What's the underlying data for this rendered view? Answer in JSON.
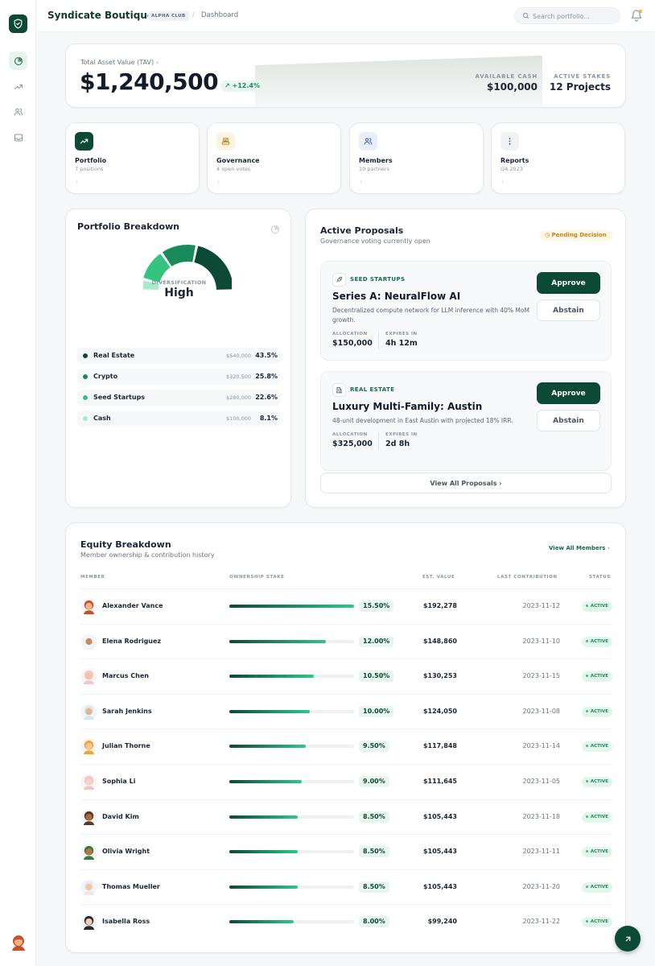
{
  "header": {
    "brand": "Syndicate Boutique",
    "badge": "ALPHA CLUB",
    "separator": "/",
    "breadcrumb": "Dashboard",
    "search_placeholder": "Search portfolio..."
  },
  "sidebar": {
    "items": [
      {
        "icon": "pie-chart-icon",
        "active": true
      },
      {
        "icon": "trending-up-icon",
        "active": false
      },
      {
        "icon": "users-icon",
        "active": false
      },
      {
        "icon": "inbox-icon",
        "active": false
      }
    ]
  },
  "tav": {
    "label": "Total Asset Value (TAV)",
    "value": "$1,240,500",
    "change": "+12.4%",
    "available_cash_label": "AVAILABLE CASH",
    "available_cash": "$100,000",
    "active_stakes_label": "ACTIVE STAKES",
    "active_stakes": "12 Projects"
  },
  "quick_links": [
    {
      "title": "Portfolio",
      "sub": "7 positions",
      "icon": "trending-up-icon"
    },
    {
      "title": "Governance",
      "sub": "4 open votes",
      "icon": "ballot-icon"
    },
    {
      "title": "Members",
      "sub": "10 partners",
      "icon": "users-icon"
    },
    {
      "title": "Reports",
      "sub": "Q4 2023",
      "icon": "more-vertical-icon"
    }
  ],
  "portfolio": {
    "title": "Portfolio Breakdown",
    "gauge_label": "DIVERSIFICATION",
    "gauge_value": "High",
    "allocations": [
      {
        "name": "Real Estate",
        "amount": "$540,000",
        "percent": "43.5%",
        "value": 43.5,
        "color": "#0d4a36"
      },
      {
        "name": "Crypto",
        "amount": "$320,500",
        "percent": "25.8%",
        "value": 25.8,
        "color": "#1b8a5a"
      },
      {
        "name": "Seed Startups",
        "amount": "$280,000",
        "percent": "22.6%",
        "value": 22.6,
        "color": "#34c47f"
      },
      {
        "name": "Cash",
        "amount": "$100,000",
        "percent": "8.1%",
        "value": 8.1,
        "color": "#a7ecc9"
      }
    ]
  },
  "proposals": {
    "title": "Active Proposals",
    "subtitle": "Governance voting currently open",
    "status": "Pending Decision",
    "approve_label": "Approve",
    "abstain_label": "Abstain",
    "allocation_label": "ALLOCATION",
    "expires_label": "EXPIRES IN",
    "items": [
      {
        "tag": "SEED STARTUPS",
        "title": "Series A: NeuralFlow AI",
        "description": "Decentralized compute network for LLM inference with 40% MoM growth.",
        "allocation": "$150,000",
        "expires": "4h 12m"
      },
      {
        "tag": "REAL ESTATE",
        "title": "Luxury Multi-Family: Austin",
        "description": "48-unit development in East Austin with projected 18% IRR.",
        "allocation": "$325,000",
        "expires": "2d 8h"
      }
    ],
    "view_all": "View All Proposals"
  },
  "equity": {
    "title": "Equity Breakdown",
    "subtitle": "Member ownership & contribution history",
    "view_all": "View All Members",
    "columns": [
      "MEMBER",
      "OWNERSHIP STAKE",
      "EST. VALUE",
      "LAST CONTRIBUTION",
      "STATUS"
    ],
    "members": [
      {
        "name": "Alexander Vance",
        "stake": "15.50%",
        "fill": 1.0,
        "value": "$192,278",
        "date": "2023-11-12",
        "status": "ACTIVE",
        "hair": "#c8502a",
        "skin": "#f2b48a"
      },
      {
        "name": "Elena Rodriguez",
        "stake": "12.00%",
        "fill": 0.774,
        "value": "$148,860",
        "date": "2023-11-10",
        "status": "ACTIVE",
        "hair": "#f3f4f6",
        "skin": "#c98a5c"
      },
      {
        "name": "Marcus Chen",
        "stake": "10.50%",
        "fill": 0.677,
        "value": "$130,253",
        "date": "2023-11-15",
        "status": "ACTIVE",
        "hair": "#f6c7c9",
        "skin": "#f4c2a6"
      },
      {
        "name": "Sarah Jenkins",
        "stake": "10.00%",
        "fill": 0.645,
        "value": "$124,050",
        "date": "2023-11-08",
        "status": "ACTIVE",
        "hair": "#cfe9ef",
        "skin": "#e9b08e"
      },
      {
        "name": "Julian Thorne",
        "stake": "9.50%",
        "fill": 0.613,
        "value": "$117,848",
        "date": "2023-11-14",
        "status": "ACTIVE",
        "hair": "#f6a432",
        "skin": "#f6c59a"
      },
      {
        "name": "Sophia Li",
        "stake": "9.00%",
        "fill": 0.581,
        "value": "$111,645",
        "date": "2023-11-05",
        "status": "ACTIVE",
        "hair": "#f3c4c9",
        "skin": "#f7d2bf"
      },
      {
        "name": "David Kim",
        "stake": "8.50%",
        "fill": 0.548,
        "value": "$105,443",
        "date": "2023-11-18",
        "status": "ACTIVE",
        "hair": "#5b3920",
        "skin": "#a86a3e"
      },
      {
        "name": "Olivia Wright",
        "stake": "8.50%",
        "fill": 0.548,
        "value": "$105,443",
        "date": "2023-11-11",
        "status": "ACTIVE",
        "hair": "#3d7a3a",
        "skin": "#b67548"
      },
      {
        "name": "Thomas Mueller",
        "stake": "8.50%",
        "fill": 0.548,
        "value": "$105,443",
        "date": "2023-11-20",
        "status": "ACTIVE",
        "hair": "#e9e9ec",
        "skin": "#f2c7a3"
      },
      {
        "name": "Isabella Ross",
        "stake": "8.00%",
        "fill": 0.516,
        "value": "$99,240",
        "date": "2023-11-22",
        "status": "ACTIVE",
        "hair": "#2a2a2e",
        "skin": "#f4cdb4"
      }
    ]
  },
  "colors": {
    "brand": "#0d4a36",
    "accent": "#2cc98a",
    "pending": "#c7831c"
  }
}
